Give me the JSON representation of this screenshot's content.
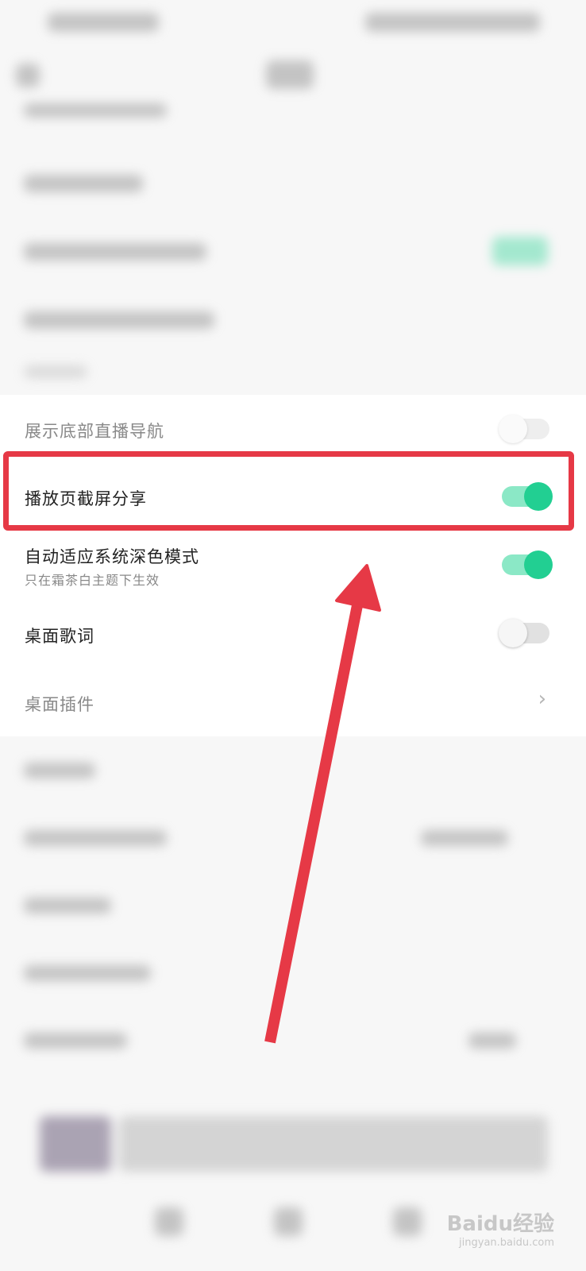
{
  "settings": {
    "rows": [
      {
        "label": "展示底部直播导航",
        "toggle": "off",
        "dim": true
      },
      {
        "label": "播放页截屏分享",
        "toggle": "on"
      },
      {
        "label": "自动适应系统深色模式",
        "sub": "只在霜茶白主题下生效",
        "toggle": "on"
      },
      {
        "label": "桌面歌词",
        "toggle": "off"
      },
      {
        "label": "桌面插件",
        "dim": true,
        "chevron": "chevron-right-icon"
      }
    ]
  },
  "watermark": {
    "brand": "Baidu经验",
    "url": "jingyan.baidu.com"
  },
  "colors": {
    "accent_green": "#22cf92",
    "highlight_red": "#e63946"
  }
}
